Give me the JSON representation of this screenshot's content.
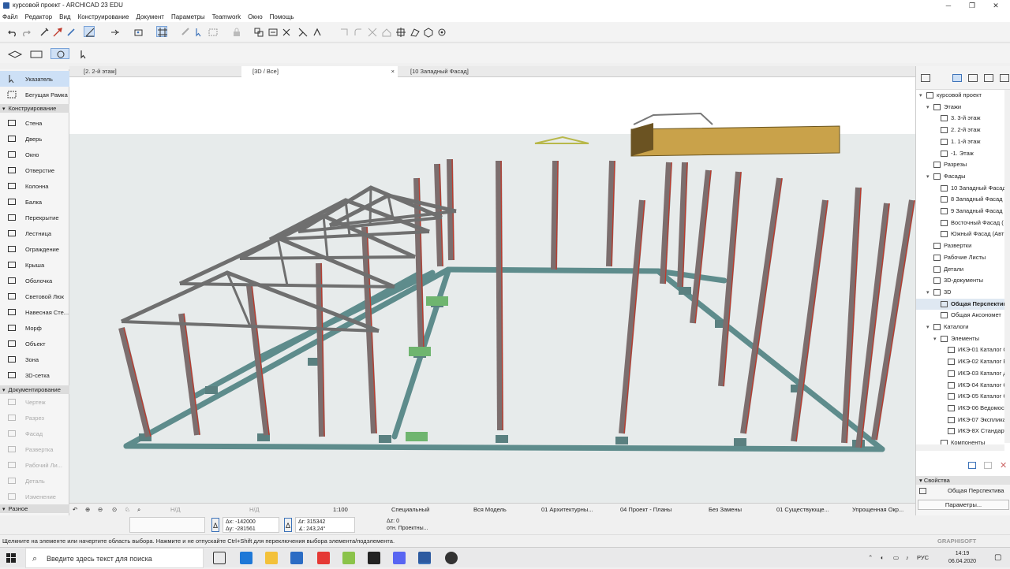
{
  "window": {
    "title": "курсовой проект - ARCHICAD 23 EDU",
    "controls": [
      "─",
      "❐",
      "✕"
    ]
  },
  "menu": [
    "Файл",
    "Редактор",
    "Вид",
    "Конструирование",
    "Документ",
    "Параметры",
    "Teamwork",
    "Окно",
    "Помощь"
  ],
  "toolbox": {
    "pointer": "Указатель",
    "marquee": "Бегущая Рамка",
    "section_construction": "Конструирование",
    "construction_tools": [
      "Стена",
      "Дверь",
      "Окно",
      "Отверстие",
      "Колонна",
      "Балка",
      "Перекрытие",
      "Лестница",
      "Ограждение",
      "Крыша",
      "Оболочка",
      "Световой Люк",
      "Навесная Сте...",
      "Морф",
      "Объект",
      "Зона",
      "3D-сетка"
    ],
    "section_documentation": "Документирование",
    "documentation_tools": [
      "Чертеж",
      "Разрез",
      "Фасад",
      "Развертка",
      "Рабочий Ли...",
      "Деталь",
      "Изменение"
    ],
    "section_misc": "Разное"
  },
  "tabs": [
    {
      "label": "[2. 2-й этаж]",
      "active": false
    },
    {
      "label": "[3D / Все]",
      "active": true,
      "close": "×"
    },
    {
      "label": "[10 Западный Фасад]",
      "active": false
    }
  ],
  "navigator": {
    "items": [
      {
        "label": "курсовой проект",
        "level": 0,
        "expanded": true
      },
      {
        "label": "Этажи",
        "level": 1,
        "expanded": true
      },
      {
        "label": "3. 3-й этаж",
        "level": 2
      },
      {
        "label": "2. 2-й этаж",
        "level": 2
      },
      {
        "label": "1. 1-й этаж",
        "level": 2
      },
      {
        "label": "-1. Этаж",
        "level": 2
      },
      {
        "label": "Разрезы",
        "level": 1
      },
      {
        "label": "Фасады",
        "level": 1,
        "expanded": true
      },
      {
        "label": "10 Западный Фасад",
        "level": 2
      },
      {
        "label": "8 Западный Фасад",
        "level": 2
      },
      {
        "label": "9 Западный Фасад",
        "level": 2
      },
      {
        "label": "Восточный Фасад (",
        "level": 2
      },
      {
        "label": "Южный Фасад (Авт",
        "level": 2
      },
      {
        "label": "Развертки",
        "level": 1
      },
      {
        "label": "Рабочие Листы",
        "level": 1
      },
      {
        "label": "Детали",
        "level": 1
      },
      {
        "label": "3D-документы",
        "level": 1
      },
      {
        "label": "3D",
        "level": 1,
        "expanded": true
      },
      {
        "label": "Общая Перспектив",
        "level": 2,
        "selected": true
      },
      {
        "label": "Общая Аксономет",
        "level": 2
      },
      {
        "label": "Каталоги",
        "level": 1,
        "expanded": true
      },
      {
        "label": "Элементы",
        "level": 2,
        "expanded": true
      },
      {
        "label": "ИКЭ-01 Каталог С",
        "level": 3
      },
      {
        "label": "ИКЭ-02 Каталог Е",
        "level": 3
      },
      {
        "label": "ИКЭ-03 Каталог Д",
        "level": 3
      },
      {
        "label": "ИКЭ-04 Каталог С",
        "level": 3
      },
      {
        "label": "ИКЭ-05 Каталог С",
        "level": 3
      },
      {
        "label": "ИКЭ-06 Ведомост",
        "level": 3
      },
      {
        "label": "ИКЭ-07 Экспликац",
        "level": 3
      },
      {
        "label": "ИКЭ-8Х Стандарт",
        "level": 3
      },
      {
        "label": "Компоненты",
        "level": 2
      }
    ]
  },
  "properties": {
    "header": "Свойства",
    "view_name": "Общая Перспектива",
    "button": "Параметры..."
  },
  "bottombar": {
    "na1": "Н/Д",
    "na2": "Н/Д",
    "scale": "1:100",
    "layer_combo": "Специальный",
    "model": "Вся Модель",
    "pen_set": "01 Архитектурны...",
    "model_view": "04 Проект - Планы",
    "override": "Без Замены",
    "renovation": "01 Существующе...",
    "structure": "Упрощенная Окр..."
  },
  "coords": {
    "dx": "Δx: -142000",
    "dy": "Δy: -281561",
    "dr": "Δr: 315342",
    "da": "∡: 243,24°",
    "dz": "Δz: 0",
    "ref": "отн. Проектны..."
  },
  "status": "Щелкните на элементе или начертите область выбора. Нажмите и не отпускайте Ctrl+Shift для переключения выбора элемента/подэлемента.",
  "brand": "GRAPHISOFT",
  "taskbar": {
    "search_placeholder": "Введите здесь текст для поиска",
    "lang": "РУС",
    "time": "14:19",
    "date": "06.04.2020"
  },
  "colors": {
    "accent": "#3d73b9",
    "selection": "#cde0f6",
    "column": "#7c6e6e",
    "column_edge": "#c0392b",
    "beam": "#5e8c8c",
    "truss": "#6f6f6f",
    "footing": "#6fb56f",
    "building": "#c9a24a"
  }
}
